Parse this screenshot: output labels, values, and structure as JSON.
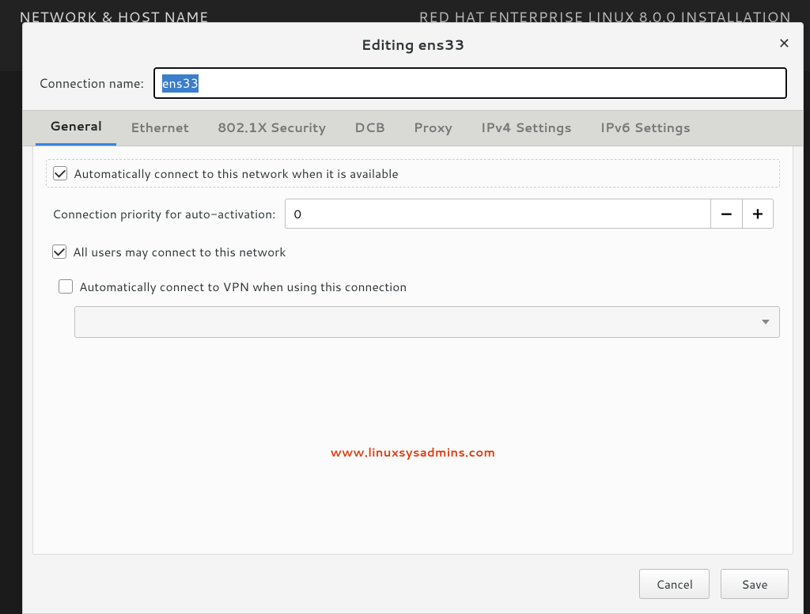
{
  "background": {
    "left_title": "NETWORK & HOST NAME",
    "right_title": "RED HAT ENTERPRISE LINUX 8.0.0 INSTALLATION"
  },
  "dialog": {
    "title": "Editing ens33",
    "close_aria": "Close"
  },
  "connection": {
    "label": "Connection name:",
    "value": "ens33"
  },
  "tabs": [
    {
      "label": "General",
      "active": true
    },
    {
      "label": "Ethernet",
      "active": false
    },
    {
      "label": "802.1X Security",
      "active": false
    },
    {
      "label": "DCB",
      "active": false
    },
    {
      "label": "Proxy",
      "active": false
    },
    {
      "label": "IPv4 Settings",
      "active": false
    },
    {
      "label": "IPv6 Settings",
      "active": false
    }
  ],
  "general": {
    "auto_connect": {
      "label": "Automatically connect to this network when it is available",
      "checked": true
    },
    "priority": {
      "label": "Connection priority for auto-activation:",
      "value": "0",
      "minus": "−",
      "plus": "+"
    },
    "all_users": {
      "label": "All users may connect to this network",
      "checked": true
    },
    "auto_vpn": {
      "label": "Automatically connect to VPN when using this connection",
      "checked": false
    },
    "vpn_selected": ""
  },
  "watermark": "www.linuxsysadmins.com",
  "buttons": {
    "cancel": "Cancel",
    "save": "Save"
  }
}
